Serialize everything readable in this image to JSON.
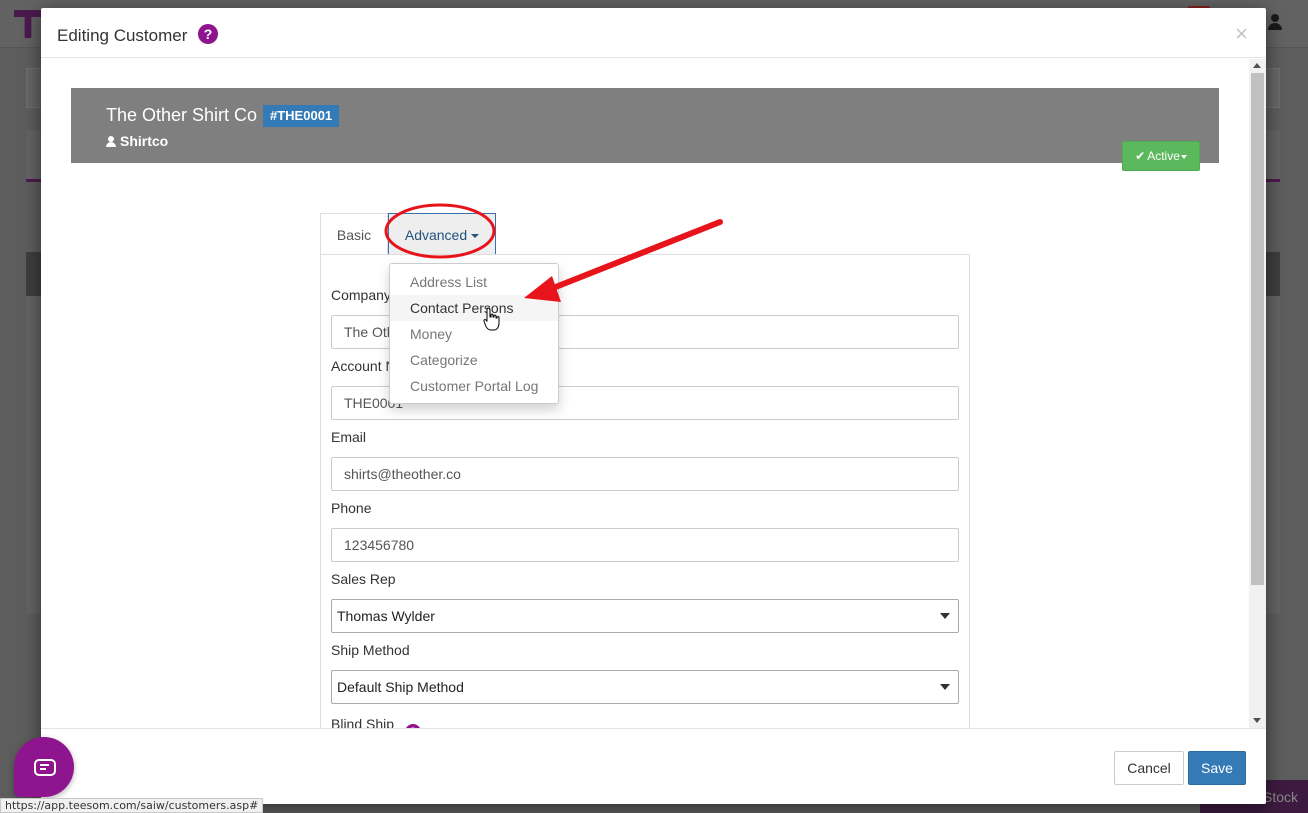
{
  "modal": {
    "title": "Editing Customer",
    "help_icon": "question-circle-icon",
    "close_glyph": "×"
  },
  "customer": {
    "name": "The Other Shirt Co",
    "code": "#THE0001",
    "nickname": "Shirtco",
    "status": "Active"
  },
  "tabs": {
    "basic": "Basic",
    "advanced": "Advanced"
  },
  "advanced_menu": {
    "items": [
      "Address List",
      "Contact Persons",
      "Money",
      "Categorize",
      "Customer Portal Log"
    ],
    "highlighted": "Contact Persons"
  },
  "form": {
    "company_label": "Company",
    "company_value": "The Other Shirt Co",
    "company_value_visible": "The Oth",
    "account_label": "Account N",
    "account_value": "THE0001",
    "email_label": "Email",
    "email_value": "shirts@theother.co",
    "phone_label": "Phone",
    "phone_value": "123456780",
    "sales_rep_label": "Sales Rep",
    "sales_rep_value": "Thomas Wylder",
    "ship_method_label": "Ship Method",
    "ship_method_value": "Default Ship Method",
    "blind_ship_label": "Blind Ship"
  },
  "footer": {
    "cancel": "Cancel",
    "save": "Save"
  },
  "background": {
    "stock_button": "Stock"
  },
  "status_bar_url": "https://app.teesom.com/saiw/customers.asp#",
  "colors": {
    "brand_purple": "#8e158e",
    "primary_blue": "#337ab7",
    "success_green": "#5cb85c",
    "annotation_red": "#e8141b"
  }
}
